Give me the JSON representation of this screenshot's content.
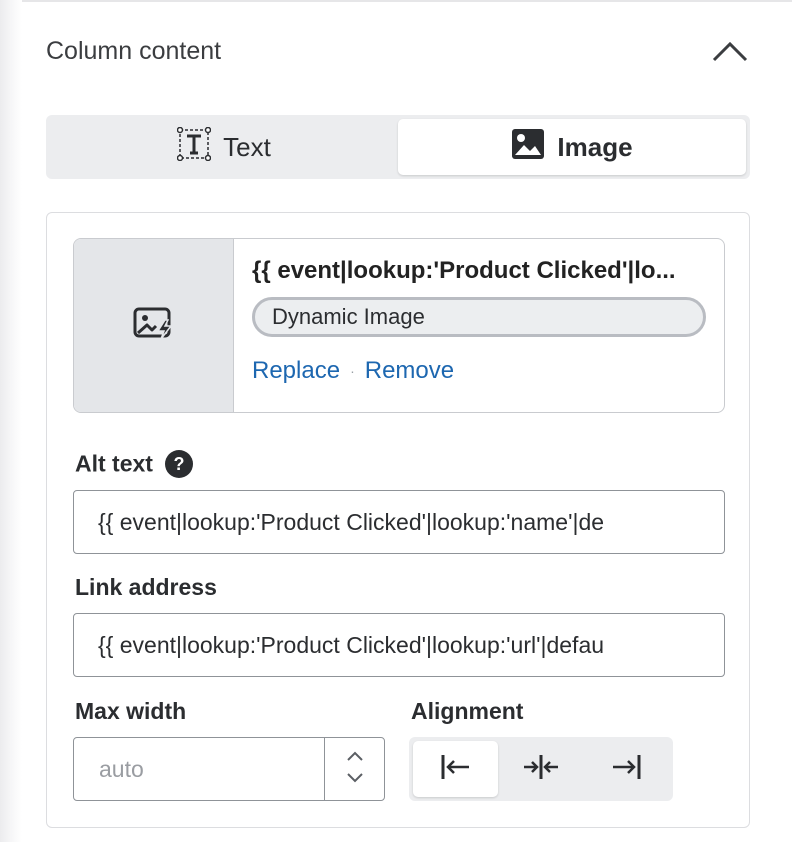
{
  "section": {
    "title": "Column content"
  },
  "content_type": {
    "options": [
      {
        "label": "Text",
        "icon": "text-format-icon",
        "selected": false
      },
      {
        "label": "Image",
        "icon": "image-icon",
        "selected": true
      }
    ]
  },
  "image": {
    "title": "{{ event|lookup:'Product Clicked'|lo...",
    "badge": "Dynamic Image",
    "replace_label": "Replace",
    "remove_label": "Remove",
    "separator": "·",
    "thumbnail_icon": "dynamic-image-icon"
  },
  "alt_text": {
    "label": "Alt text",
    "help_glyph": "?",
    "value": "{{ event|lookup:'Product Clicked'|lookup:'name'|de"
  },
  "link_address": {
    "label": "Link address",
    "value": "{{ event|lookup:'Product Clicked'|lookup:'url'|defau"
  },
  "max_width": {
    "label": "Max width",
    "placeholder": "auto"
  },
  "alignment": {
    "label": "Alignment",
    "options": [
      "left",
      "center",
      "right"
    ],
    "selected": "left"
  },
  "colors": {
    "link": "#1d67b0",
    "segment_bg": "#ecedef",
    "thumbnail_bg": "#e4e6e9"
  }
}
